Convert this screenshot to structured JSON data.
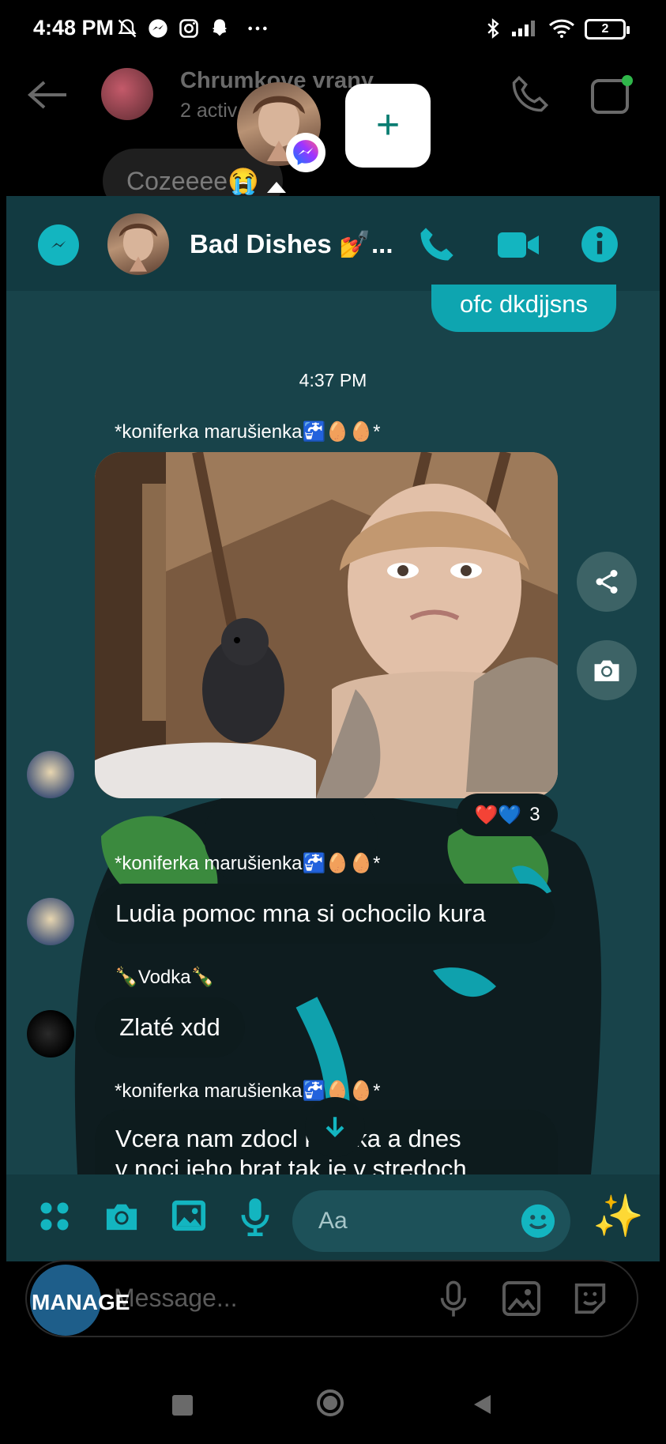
{
  "status_bar": {
    "time": "4:48 PM",
    "battery": "2"
  },
  "background_chat": {
    "title": "Chrumkove vrany",
    "subtitle": "2 activ",
    "last_message": "Cozeeee😭"
  },
  "bubble_heads": {
    "add_label": "+"
  },
  "chat": {
    "title": "Bad Dishes 💅...",
    "timestamp": "4:37 PM",
    "messages": [
      {
        "type": "sent",
        "text": "ofc dkdjjsns"
      },
      {
        "type": "image",
        "sender": "*koniferka marušienka🚰🥚🥚*",
        "reactions": "❤️💙",
        "reaction_count": "3"
      },
      {
        "type": "received",
        "sender": "*koniferka marušienka🚰🥚🥚*",
        "text": "Ludia pomoc mna si ochocilo kura"
      },
      {
        "type": "received",
        "sender": "🍾Vodka🍾",
        "text": "Zlaté xdd"
      },
      {
        "type": "received",
        "sender": "*koniferka marušienka🚰🥚🥚*",
        "text": "Vcera nam zdocl kvocka a dnes\nv noci jeho brat tak je v stredoch"
      }
    ]
  },
  "composer": {
    "placeholder": "Aa",
    "magic_label": "✨"
  },
  "underlying_composer": {
    "manage_label": "MANAGE",
    "placeholder": "Message..."
  },
  "colors": {
    "panel_bg": "#18434a",
    "header_bg": "#123a41",
    "accent": "#13b5c0",
    "sent_bubble": "#0ea5b0",
    "received_bubble": "#0d1b1d"
  }
}
